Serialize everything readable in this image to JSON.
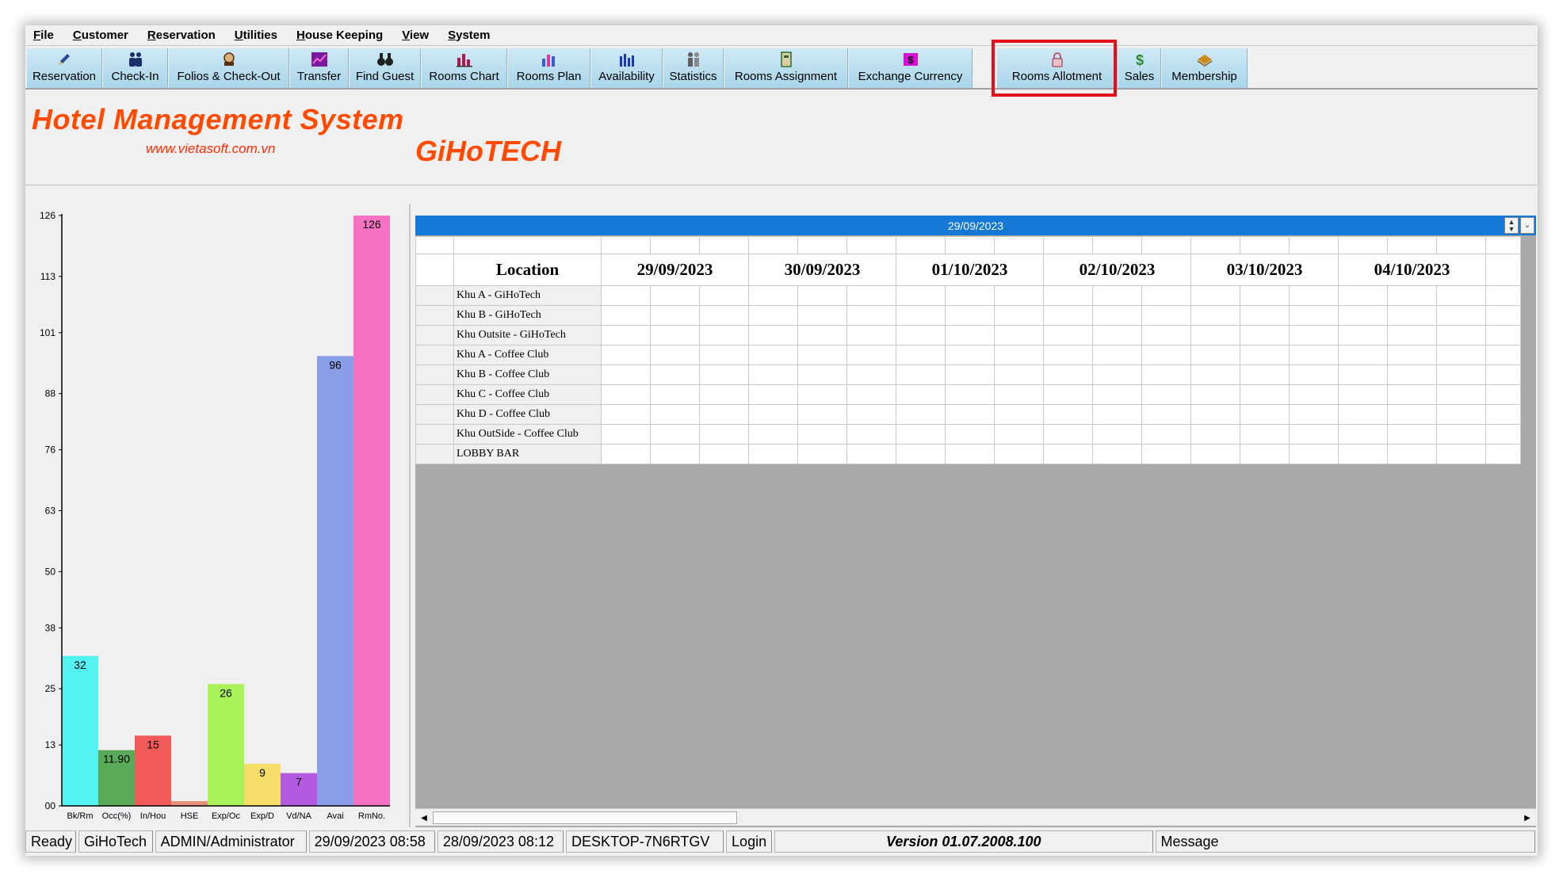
{
  "menu": [
    {
      "label": "File",
      "key": "F",
      "rest": "ile"
    },
    {
      "label": "Customer",
      "key": "C",
      "rest": "ustomer"
    },
    {
      "label": "Reservation",
      "key": "R",
      "rest": "eservation"
    },
    {
      "label": "Utilities",
      "key": "U",
      "rest": "tilities"
    },
    {
      "label": "House Keeping",
      "key": "H",
      "rest": "ouse Keeping"
    },
    {
      "label": "View",
      "key": "V",
      "rest": "iew"
    },
    {
      "label": "System",
      "key": "S",
      "rest": "ystem"
    }
  ],
  "toolbar": {
    "buttons": [
      {
        "label": "Reservation",
        "icon": "pen-icon",
        "color": "#2b4c9a"
      },
      {
        "label": "Check-In",
        "icon": "people-icon",
        "color": "#1d2f6b"
      },
      {
        "label": "Folios & Check-Out",
        "icon": "folio-icon",
        "color": "#5a2d0c"
      },
      {
        "label": "Transfer",
        "icon": "transfer-chart-icon",
        "color": "#7a1aa0"
      },
      {
        "label": "Find Guest",
        "icon": "binoculars-icon",
        "color": "#222222"
      },
      {
        "label": "Rooms Chart",
        "icon": "rooms-chart-icon",
        "color": "#b4154a"
      },
      {
        "label": "Rooms Plan",
        "icon": "rooms-plan-icon",
        "color": "#3b5bd0"
      },
      {
        "label": "Availability",
        "icon": "availability-icon",
        "color": "#1a37b5"
      },
      {
        "label": "Statistics",
        "icon": "statistics-icon",
        "color": "#5f5f5f"
      },
      {
        "label": "Rooms Assignment",
        "icon": "rooms-assignment-icon",
        "color": "#2f6b2f"
      },
      {
        "label": "Exchange Currency",
        "icon": "currency-icon",
        "color": "#d70fd7"
      },
      {
        "label": "Rooms Allotment",
        "icon": "lock-icon",
        "color": "#b05a70"
      },
      {
        "label": "Sales",
        "icon": "sales-icon",
        "color": "#2e8a2e"
      },
      {
        "label": "Membership",
        "icon": "membership-icon",
        "color": "#d08a1a"
      }
    ],
    "highlight_color": "#e4101c"
  },
  "banner": {
    "title": "Hotel Management System",
    "url": "www.vietasoft.com.vn",
    "brand": "GiHoTECH",
    "color": "#ff4a00"
  },
  "chart_data": {
    "type": "bar",
    "categories": [
      "Bk/Rm",
      "Occ(%)",
      "In/Hou",
      "HSE",
      "Exp/Oc",
      "Exp/D",
      "Vd/NA",
      "Avai",
      "RmNo."
    ],
    "values": [
      32,
      11.9,
      15,
      1,
      26,
      9,
      7,
      96,
      126
    ],
    "value_labels": [
      "32",
      "11.90",
      "15",
      "1",
      "26",
      "9",
      "7",
      "96",
      "126"
    ],
    "colors": [
      "#55f2f2",
      "#5aaa5a",
      "#f25a5a",
      "#e8907a",
      "#aaf25a",
      "#f5de6a",
      "#b35ae0",
      "#8a9ee8",
      "#f572c2"
    ],
    "ytick_labels": [
      "00",
      "13",
      "25",
      "38",
      "50",
      "63",
      "76",
      "88",
      "101",
      "113",
      "126"
    ],
    "ylim": [
      0,
      126
    ]
  },
  "grid": {
    "selected_date": "29/09/2023",
    "location_header": "Location",
    "dates": [
      "29/09/2023",
      "30/09/2023",
      "01/10/2023",
      "02/10/2023",
      "03/10/2023",
      "04/10/2023"
    ],
    "locations": [
      "Khu A - GiHoTech",
      "Khu B - GiHoTech",
      "Khu Outsite - GiHoTech",
      "Khu A - Coffee Club",
      "Khu B - Coffee Club",
      "Khu C - Coffee Club",
      "Khu D - Coffee Club",
      "Khu OutSide - Coffee Club",
      "LOBBY BAR"
    ]
  },
  "statusbar": {
    "ready": "Ready",
    "company": "GiHoTech",
    "user": "ADMIN/Administrator",
    "current_time": "29/09/2023 08:58",
    "login_time": "28/09/2023 08:12",
    "machine": "DESKTOP-7N6RTGV",
    "login": "Login",
    "version": "Version 01.07.2008.100",
    "message": "Message"
  }
}
